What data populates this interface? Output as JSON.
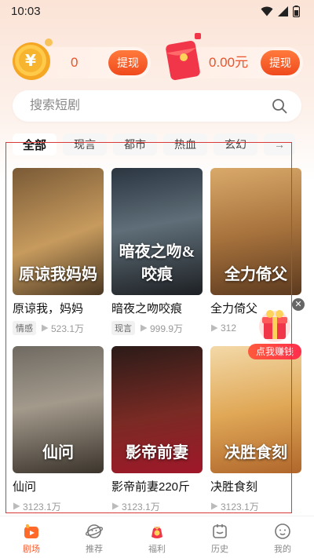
{
  "status_bar": {
    "time": "10:03"
  },
  "wallet": {
    "coins_value": "0",
    "coins_button": "提现",
    "cash_value": "0.00元",
    "cash_button": "提现"
  },
  "search": {
    "placeholder": "搜索短剧"
  },
  "tabs": [
    {
      "label": "全部",
      "active": true
    },
    {
      "label": "现言"
    },
    {
      "label": "都市"
    },
    {
      "label": "热血"
    },
    {
      "label": "玄幻"
    }
  ],
  "dramas": [
    {
      "title": "原谅我，妈妈",
      "tag": "情感",
      "plays": "523.1万",
      "poster_text": "原谅我妈妈"
    },
    {
      "title": "暗夜之吻咬痕",
      "tag": "现言",
      "plays": "999.9万",
      "poster_text": "暗夜之吻&咬痕"
    },
    {
      "title": "全力倚父",
      "tag": "",
      "plays": "312",
      "poster_text": "全力倚父"
    },
    {
      "title": "仙问",
      "tag": "",
      "plays": "3123.1万",
      "poster_text": "仙问"
    },
    {
      "title": "影帝前妻220斤",
      "tag": "",
      "plays": "3123.1万",
      "poster_text": "影帝前妻"
    },
    {
      "title": "决胜食刻",
      "tag": "",
      "plays": "3123.1万",
      "poster_text": "决胜食刻"
    }
  ],
  "promo": {
    "label": "点我赚钱"
  },
  "bottom_nav": [
    {
      "label": "剧场",
      "icon": "theater-icon",
      "active": true
    },
    {
      "label": "推荐",
      "icon": "recommend-icon"
    },
    {
      "label": "福利",
      "icon": "welfare-icon"
    },
    {
      "label": "历史",
      "icon": "history-icon"
    },
    {
      "label": "我的",
      "icon": "profile-icon"
    }
  ],
  "colors": {
    "accent": "#ff5a2b",
    "highlight_box": "#d83a3a"
  }
}
